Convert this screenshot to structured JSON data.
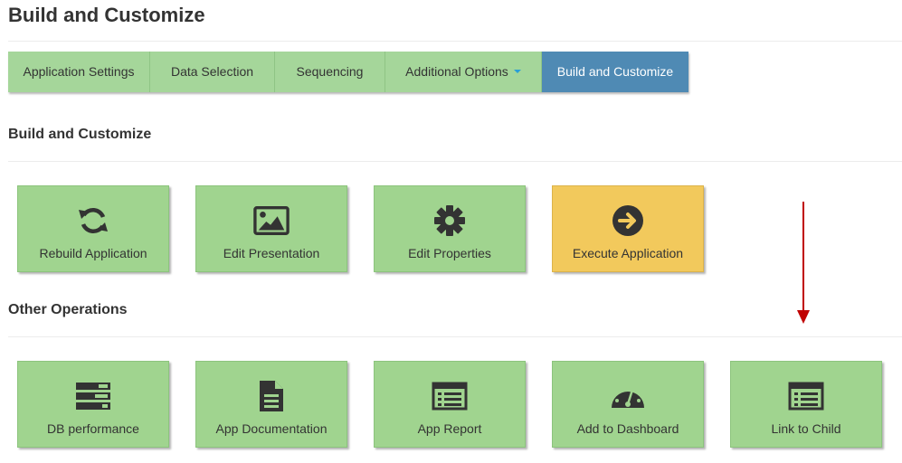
{
  "page": {
    "title": "Build and Customize"
  },
  "tabs": [
    {
      "label": "Application Settings",
      "active": false
    },
    {
      "label": "Data Selection",
      "active": false
    },
    {
      "label": "Sequencing",
      "active": false
    },
    {
      "label": "Additional Options",
      "active": false,
      "has_dropdown": true
    },
    {
      "label": "Build and Customize",
      "active": true
    }
  ],
  "sections": {
    "build": {
      "heading": "Build and Customize",
      "tiles": [
        {
          "label": "Rebuild Application",
          "icon": "refresh-icon"
        },
        {
          "label": "Edit Presentation",
          "icon": "image-icon"
        },
        {
          "label": "Edit Properties",
          "icon": "gear-icon"
        },
        {
          "label": "Execute Application",
          "icon": "arrow-circle-right-icon",
          "highlight": true
        }
      ]
    },
    "other": {
      "heading": "Other Operations",
      "tiles": [
        {
          "label": "DB performance",
          "icon": "server-icon"
        },
        {
          "label": "App Documentation",
          "icon": "document-icon"
        },
        {
          "label": "App Report",
          "icon": "list-icon"
        },
        {
          "label": "Add to Dashboard",
          "icon": "dashboard-gauge-icon"
        },
        {
          "label": "Link to Child",
          "icon": "list-icon"
        }
      ]
    }
  },
  "annotation": {
    "icon": "red-down-arrow-icon",
    "color": "#c00000"
  },
  "colors": {
    "tile_green": "#a0d48f",
    "tile_yellow": "#f2c95c",
    "tab_green": "#a5d69a",
    "tab_active": "#4f8ab4",
    "icon_dark": "#333333",
    "caret": "#2a9fd6"
  }
}
